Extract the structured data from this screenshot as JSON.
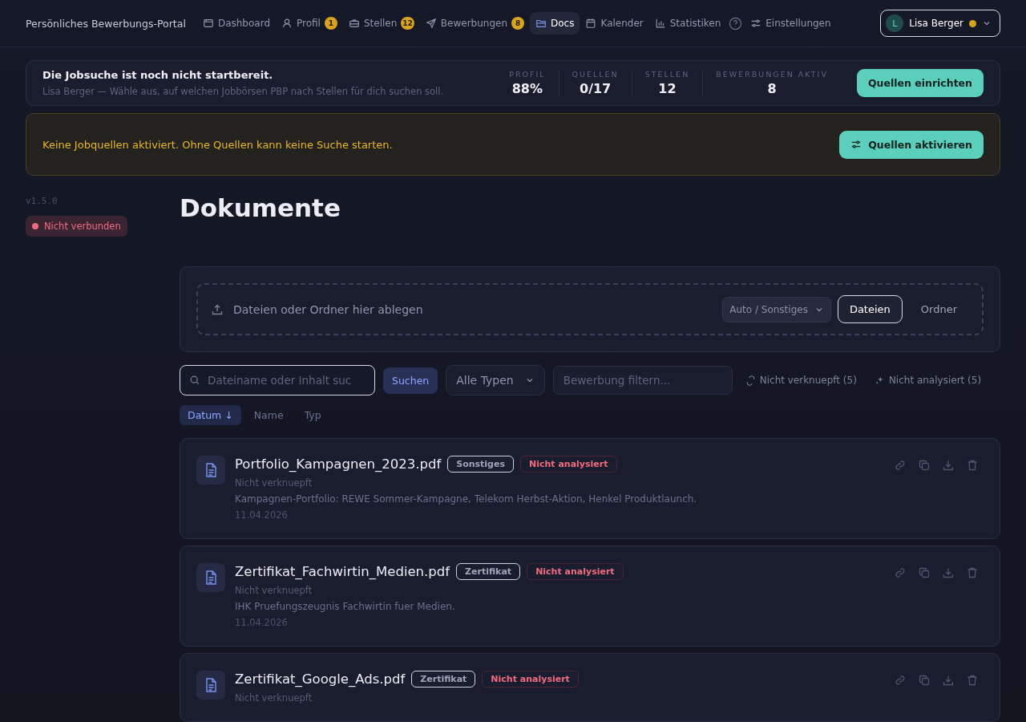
{
  "brand": "Persönliches Bewerbungs-Portal",
  "nav": [
    {
      "label": "Dashboard",
      "selected": false
    },
    {
      "label": "Profil",
      "badge": "1",
      "selected": false
    },
    {
      "label": "Stellen",
      "badge": "12",
      "selected": false
    },
    {
      "label": "Bewerbungen",
      "badge": "8",
      "selected": false
    },
    {
      "label": "Docs",
      "selected": true
    },
    {
      "label": "Kalender",
      "selected": false
    },
    {
      "label": "Statistiken",
      "selected": false
    }
  ],
  "settings_label": "Einstellungen",
  "user": {
    "initial": "L",
    "name": "Lisa Berger"
  },
  "readiness": {
    "title": "Die Jobsuche ist noch nicht startbereit.",
    "subtitle": "Lisa Berger — Wähle aus, auf welchen Jobbörsen PBP nach Stellen für dich suchen soll.",
    "stats": [
      {
        "label": "PROFIL",
        "value": "88%"
      },
      {
        "label": "QUELLEN",
        "value": "0/17"
      },
      {
        "label": "STELLEN",
        "value": "12"
      },
      {
        "label": "BEWERBUNGEN AKTIV",
        "value": "8"
      }
    ],
    "button": "Quellen einrichten"
  },
  "warning": {
    "text": "Keine Jobquellen aktiviert. Ohne Quellen kann keine Suche starten.",
    "button": "Quellen aktivieren"
  },
  "sidebar": {
    "version": "v1.5.0",
    "status": "Nicht verbunden"
  },
  "page_title": "Dokumente",
  "dropzone": {
    "text": "Dateien oder Ordner hier ablegen",
    "type_select": "Auto / Sonstiges",
    "buttons": [
      {
        "label": "Dateien",
        "selected": true
      },
      {
        "label": "Ordner",
        "selected": false
      }
    ]
  },
  "filters": {
    "search_placeholder": "Dateiname oder Inhalt suc",
    "search_button": "Suchen",
    "type_select": "Alle Typen",
    "application_placeholder": "Bewerbung filtern...",
    "unlinked": "Nicht verknuepft (5)",
    "unanalyzed": "Nicht analysiert (5)"
  },
  "sort": [
    {
      "label": "Datum ↓",
      "selected": true
    },
    {
      "label": "Name",
      "selected": false
    },
    {
      "label": "Typ",
      "selected": false
    }
  ],
  "documents": [
    {
      "name": "Portfolio_Kampagnen_2023.pdf",
      "type": "Sonstiges",
      "status": "Nicht analysiert",
      "link": "Nicht verknuepft",
      "description": "Kampagnen-Portfolio: REWE Sommer-Kampagne, Telekom Herbst-Aktion, Henkel Produktlaunch.",
      "date": "11.04.2026"
    },
    {
      "name": "Zertifikat_Fachwirtin_Medien.pdf",
      "type": "Zertifikat",
      "status": "Nicht analysiert",
      "link": "Nicht verknuepft",
      "description": "IHK Pruefungszeugnis Fachwirtin fuer Medien.",
      "date": "11.04.2026"
    },
    {
      "name": "Zertifikat_Google_Ads.pdf",
      "type": "Zertifikat",
      "status": "Nicht analysiert",
      "link": "Nicht verknuepft"
    }
  ]
}
